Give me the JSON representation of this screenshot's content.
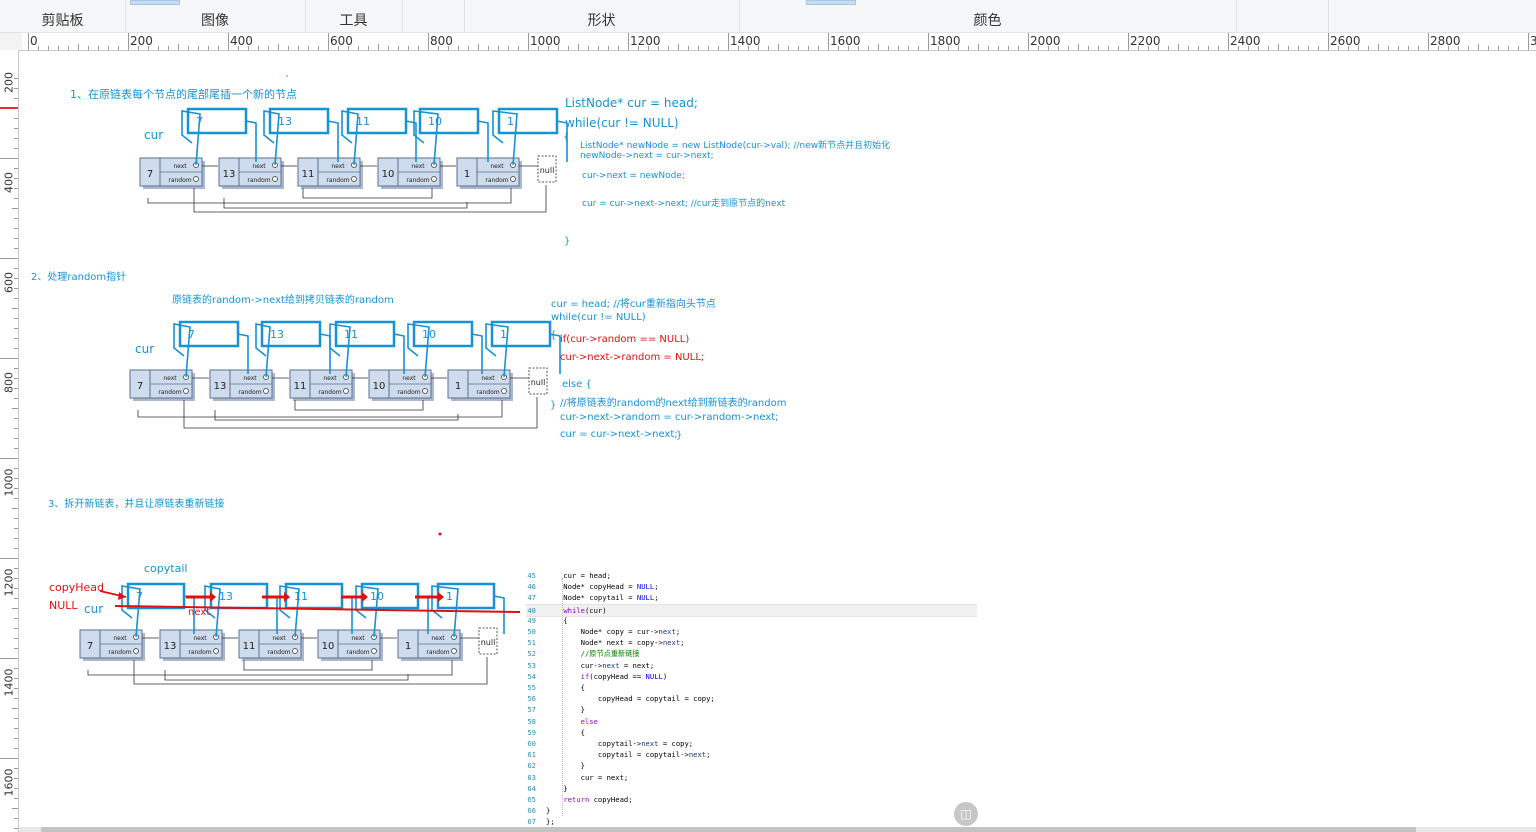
{
  "ribbon": {
    "sections": [
      "剪贴板",
      "图像",
      "工具",
      "形状",
      "颜色"
    ]
  },
  "ruler": {
    "h_ticks": [
      "0",
      "200",
      "400",
      "600",
      "800",
      "1000",
      "1200",
      "1400",
      "1600",
      "1800",
      "2000",
      "2200",
      "2400",
      "2600",
      "2800",
      "30"
    ],
    "v_ticks": [
      "200",
      "400",
      "600",
      "800",
      "1000",
      "1200",
      "1400",
      "1600"
    ]
  },
  "step1": {
    "title": "1、在原链表每个节点的尾部尾插一个新的节点",
    "cur": "cur",
    "code": [
      "ListNode* cur = head;",
      "while(cur != NULL)",
      "{",
      "ListNode* newNode = new ListNode(cur->val); //new新节点并且初始化",
      "newNode->next = cur->next;",
      "cur->next = newNode;",
      "cur = cur->next->next; //cur走到原节点的next",
      "}"
    ]
  },
  "step2": {
    "title": "2、处理random指针",
    "subtitle": "原链表的random->next给到拷贝链表的random",
    "cur": "cur",
    "code": [
      "cur = head; //将cur重新指向头节点",
      "while(cur != NULL)",
      "{",
      "if(cur->random == NULL)",
      "cur->next->random = NULL;",
      "else {",
      "//将原链表的random的next给到新链表的random",
      "cur->next->random = cur->random->next;",
      "cur = cur->next->next;",
      "}",
      "}"
    ]
  },
  "step3": {
    "title": "3、拆开新链表，并且让原链表重新链接",
    "copytail": "copytail",
    "copyhead": "copyHead",
    "null_label": "NULL",
    "cur": "cur",
    "next": "next"
  },
  "diagram": {
    "values": [
      "7",
      "13",
      "11",
      "10",
      "1"
    ],
    "next_label": "next",
    "random_label": "random",
    "null_label": "null"
  },
  "code_editor": {
    "lines": [
      {
        "n": "45",
        "t": "    cur = head;"
      },
      {
        "n": "46",
        "t": "    Node* copyHead = NULL;"
      },
      {
        "n": "47",
        "t": "    Node* copytail = NULL;"
      },
      {
        "n": "48",
        "t": "    while(cur)"
      },
      {
        "n": "49",
        "t": "    {"
      },
      {
        "n": "50",
        "t": "        Node* copy = cur->next;"
      },
      {
        "n": "51",
        "t": "        Node* next = copy->next;"
      },
      {
        "n": "52",
        "t": "        //原节点重新链接"
      },
      {
        "n": "53",
        "t": "        cur->next = next;"
      },
      {
        "n": "54",
        "t": "        if(copyHead == NULL)"
      },
      {
        "n": "55",
        "t": "        {"
      },
      {
        "n": "56",
        "t": "            copyHead = copytail = copy;"
      },
      {
        "n": "57",
        "t": "        }"
      },
      {
        "n": "58",
        "t": "        else"
      },
      {
        "n": "59",
        "t": "        {"
      },
      {
        "n": "60",
        "t": "            copytail->next = copy;"
      },
      {
        "n": "61",
        "t": "            copytail = copytail->next;"
      },
      {
        "n": "62",
        "t": "        }"
      },
      {
        "n": "63",
        "t": "        cur = next;"
      },
      {
        "n": "64",
        "t": "    }"
      },
      {
        "n": "65",
        "t": "    return copyHead;"
      },
      {
        "n": "66",
        "t": "}"
      },
      {
        "n": "67",
        "t": "};"
      }
    ]
  },
  "colors": {
    "annotation_blue": "#1593d6",
    "annotation_red": "#e01010",
    "node_fill": "#cfdcee",
    "node_stroke": "#5a6f8f"
  }
}
